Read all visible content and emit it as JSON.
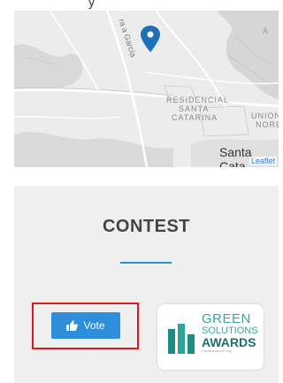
{
  "page": {
    "top_text": "y"
  },
  "map": {
    "street_label": "ra a García",
    "area_label_line1": "RESIDENCIAL",
    "area_label_line2": "SANTA",
    "area_label_line3": "CATARINA",
    "union_line1": "UNION",
    "union_line2": "NORES",
    "town_label": "Santa Cata",
    "attribution": "Leaflet",
    "corner_label": "A",
    "marker_color": "#1f6fb6"
  },
  "contest": {
    "title": "CONTEST",
    "vote_label": "Vote",
    "vote_icon": "thumbs-up-icon",
    "accent_color": "#2a8fd6",
    "award": {
      "line1": "GREEN",
      "line2": "SOLUTIONS",
      "line3": "AWARDS",
      "line4": "Construction21.org",
      "logo_icon": "building-logo-icon"
    }
  }
}
